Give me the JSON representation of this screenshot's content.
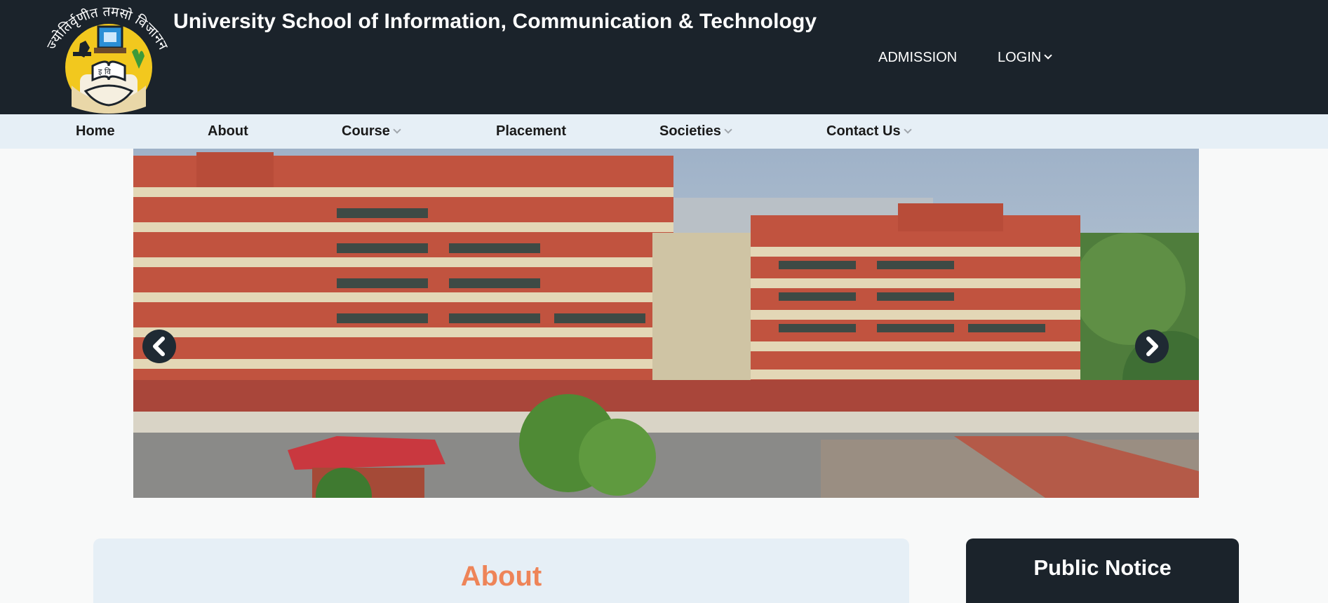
{
  "header": {
    "site_title": "University School of Information, Communication & Technology",
    "logo_arc_text": "ज्योतिर्वृणीत तमसो विजानन",
    "logo_book_text": "इ वि",
    "links": [
      {
        "label": "ADMISSION"
      },
      {
        "label": "LOGIN"
      }
    ]
  },
  "nav": {
    "items": [
      {
        "label": "Home"
      },
      {
        "label": "About"
      },
      {
        "label": "Course"
      },
      {
        "label": "Placement"
      },
      {
        "label": "Societies"
      },
      {
        "label": "Contact Us"
      }
    ]
  },
  "hero": {
    "prev_icon": "chevron-left-icon",
    "next_icon": "chevron-right-icon"
  },
  "about": {
    "title": "About"
  },
  "notice": {
    "title": "Public Notice"
  },
  "colors": {
    "header_bg": "#1b232b",
    "nav_bg": "#e6eff6",
    "accent": "#ee8458",
    "page_bg": "#f8f9f9"
  }
}
